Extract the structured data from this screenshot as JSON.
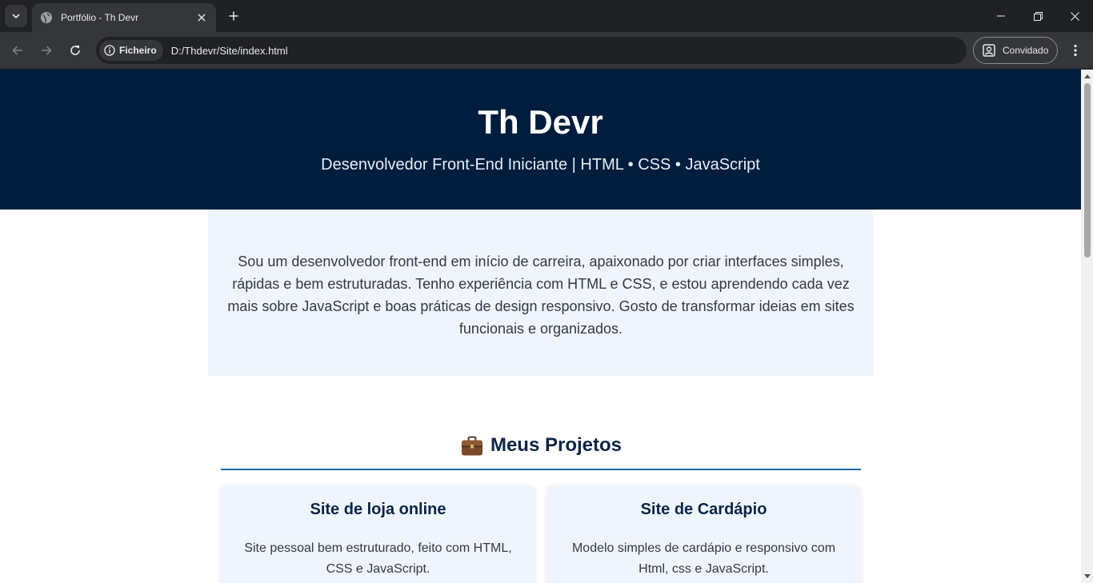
{
  "browser": {
    "tab_title": "Portfólio - Th Devr",
    "omnibox_chip": "Ficheiro",
    "url": "D:/Thdevr/Site/index.html",
    "profile_label": "Convidado"
  },
  "page": {
    "hero": {
      "title": "Th Devr",
      "subtitle": "Desenvolvedor Front-End Iniciante | HTML • CSS • JavaScript"
    },
    "about": {
      "text": "Sou um desenvolvedor front-end em início de carreira, apaixonado por criar interfaces simples, rápidas e bem estruturadas. Tenho experiência com HTML e CSS, e estou aprendendo cada vez mais sobre JavaScript e boas práticas de design responsivo. Gosto de transformar ideias em sites funcionais e organizados."
    },
    "projects": {
      "heading": "Meus Projetos",
      "heading_icon": "briefcase-icon",
      "items": [
        {
          "title": "Site de loja online",
          "description": "Site pessoal bem estruturado, feito com HTML, CSS e JavaScript."
        },
        {
          "title": "Site de Cardápio",
          "description": "Modelo simples de cardápio e responsivo com Html, css e JavaScript."
        }
      ]
    }
  },
  "colors": {
    "hero_bg": "#001d3d",
    "section_bg": "#eef5fc",
    "accent_line": "#1f6aa0",
    "heading_text": "#0b2545"
  }
}
